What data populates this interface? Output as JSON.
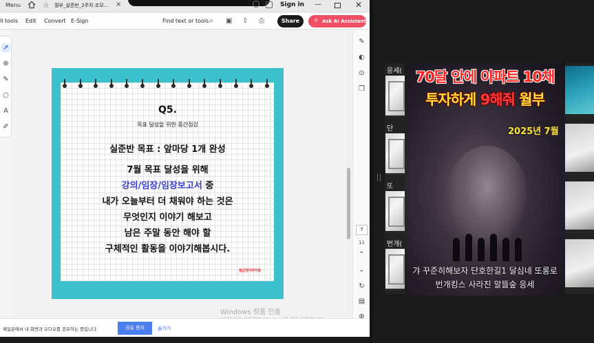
{
  "titlebar": {
    "menu_label": "Menu",
    "tab_title": "월부_실준반_2주차 조모...",
    "tab_close": "×",
    "sign_in": "Sign in",
    "minimize": "—",
    "close": "✕"
  },
  "menubar": {
    "all_tools": "ll tools",
    "edit": "Edit",
    "convert": "Convert",
    "esign": "E-Sign",
    "find": "Find text or tools",
    "share": "Share",
    "ask_ai": "Ask AI Assistant"
  },
  "page_nav": {
    "current_page": "7",
    "total_pages": "11"
  },
  "document": {
    "question": "Q5.",
    "subtitle": "목표 달성을 위한 중간점검",
    "goal": "실준반 목표 : 앞마당 1개 완성",
    "line1": "7월 목표 달성을 위해",
    "line2_blue": "강의/임장/임장보고서",
    "line2_rest": " 중",
    "line3": "내가 오늘부터 더 채워야 하는 것은",
    "line4": "무엇인지 이야기 해보고",
    "line5": "남은 주말 동안 해야 할",
    "line6": "구체적인 활동을 이야기해봅시다.",
    "brand_a": "월급쟁이",
    "brand_b": "부자들"
  },
  "notice": {
    "text": "웨일온에서 내 화면과 오디오를 공유하는 중입니다.",
    "stop_button": "공유 중지",
    "hide": "숨기기"
  },
  "watermark": {
    "line1": "Windows 정품 인증",
    "line2": "[설정]으로 이동하여 Windows를 정품 인증합니다."
  },
  "right_list": {
    "rows": [
      {
        "label": "응세("
      },
      {
        "label": "단"
      },
      {
        "label": "또"
      },
      {
        "label": "번개("
      }
    ]
  },
  "poster": {
    "line1": "70달 안에 아파트 10채",
    "line2_a": "투자하게 ",
    "line2_red": "9해줘",
    "line2_b": " 월부",
    "date": "2025년 7월",
    "sub1": "갸 꾸준히해보자 단호한길1 달심네 또롱로",
    "sub2": "번개킹스 사라진 알뜰숲 응세"
  },
  "colors": {
    "page_frame": "#3cc1cc",
    "share_button": "#1b1b1b",
    "ai_button": "#ef4f63",
    "highlight_text": "#3a3fd0"
  }
}
